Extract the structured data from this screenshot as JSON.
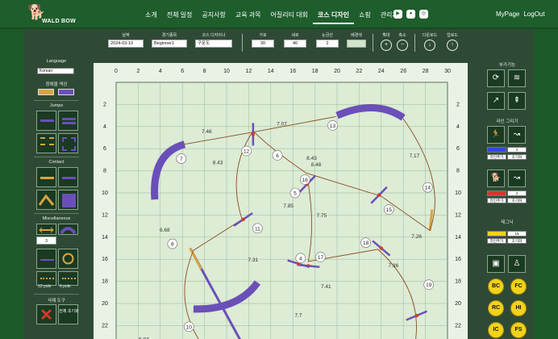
{
  "brand": {
    "name": "WALD BOW"
  },
  "nav": {
    "items": [
      "소개",
      "전체 일정",
      "공지사항",
      "교육 과목",
      "어질리티 대회",
      "코스 디자인",
      "쇼핑",
      "관리자"
    ],
    "active_index": 5
  },
  "auth": {
    "mypage": "MyPage",
    "logout": "LogOut"
  },
  "toolbar": {
    "date_label": "날짜",
    "date_value": "2024-03-10",
    "event_label": "경기종목",
    "event_value": "Beginner1",
    "designer_label": "코스 디자이너",
    "designer_value": "구문도",
    "width_label": "가로",
    "width_value": "30",
    "height_label": "세로",
    "height_value": "40",
    "grid_label": "눈금선",
    "grid_value": "2",
    "bgcolor_label": "배경색",
    "zoomin_label": "확대",
    "zoomout_label": "축소",
    "download_label": "다운로드",
    "upload_label": "업로드"
  },
  "left": {
    "language_label": "Language",
    "language_value": "Korean",
    "obstacle_color_label": "장애물 색상",
    "jumps_label": "Jumps",
    "contact_label": "Contact",
    "misc_label": "Miscellaneous",
    "misc_stepper_value": "3",
    "pole12_label": "12 pole",
    "pole6_label": "6 pole",
    "delete_tools_label": "삭제 도구",
    "clear_all_label": "전체 초기화",
    "colors": {
      "swatch1": "#d9a441",
      "swatch2": "#6b4fb8"
    }
  },
  "right": {
    "extras_label": "부가기능",
    "line_draw_label": "라인 그리기",
    "line1_value": "2",
    "line1_btn_a": "라인추가",
    "line1_btn_b": "초기화",
    "line2_value": "2",
    "line2_btn_a": "라인추가",
    "line2_btn_b": "초기화",
    "tunnel_label": "테그닉",
    "tunnel_value": "15",
    "tunnel_btn_a": "라인추가",
    "tunnel_btn_b": "초기화",
    "letters": [
      "BC",
      "FC",
      "RC",
      "HI",
      "IC",
      "FS"
    ]
  },
  "field": {
    "x_ticks": [
      "0",
      "2",
      "4",
      "6",
      "8",
      "10",
      "12",
      "14",
      "16",
      "18",
      "20",
      "22",
      "24",
      "26",
      "28",
      "30"
    ],
    "y_ticks": [
      "2",
      "4",
      "6",
      "8",
      "10",
      "12",
      "14",
      "16",
      "18",
      "20",
      "22"
    ],
    "obstacle_numbers": [
      "4",
      "5",
      "6",
      "7",
      "8",
      "10",
      "11",
      "12",
      "13",
      "14",
      "15",
      "16",
      "17",
      "18",
      "19"
    ],
    "distances": [
      "7.46",
      "7.07",
      "8.43",
      "8.43",
      "8.48",
      "7.17",
      "6.68",
      "7.85",
      "7.75",
      "7.26",
      "7.31",
      "7.36",
      "7.41",
      "7.7",
      "6.87"
    ]
  }
}
